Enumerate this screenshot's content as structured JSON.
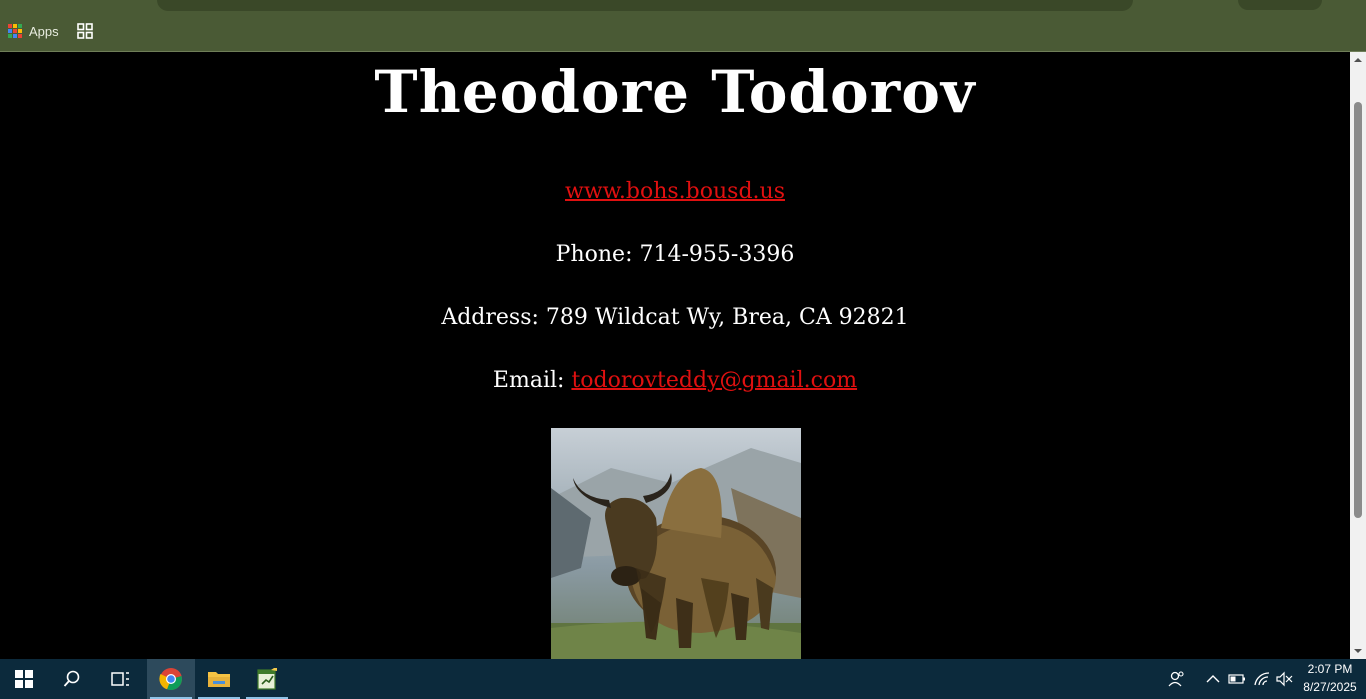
{
  "bookmarks": {
    "apps_label": "Apps"
  },
  "page": {
    "name": "Theodore Todorov",
    "website": "www.bohs.bousd.us",
    "phone": "Phone: 714-955-3396",
    "address": "Address: 789 Wildcat Wy, Brea, CA 92821",
    "email_label": "Email: ",
    "email": "todorovteddy@gmail.com"
  },
  "taskbar": {
    "time": "2:07 PM",
    "date": "8/27/2025"
  },
  "colors": {
    "chrome_bg": "#4a5a35",
    "page_bg": "#000000",
    "link": "#e01010",
    "taskbar_bg": "#0c2a3c"
  }
}
